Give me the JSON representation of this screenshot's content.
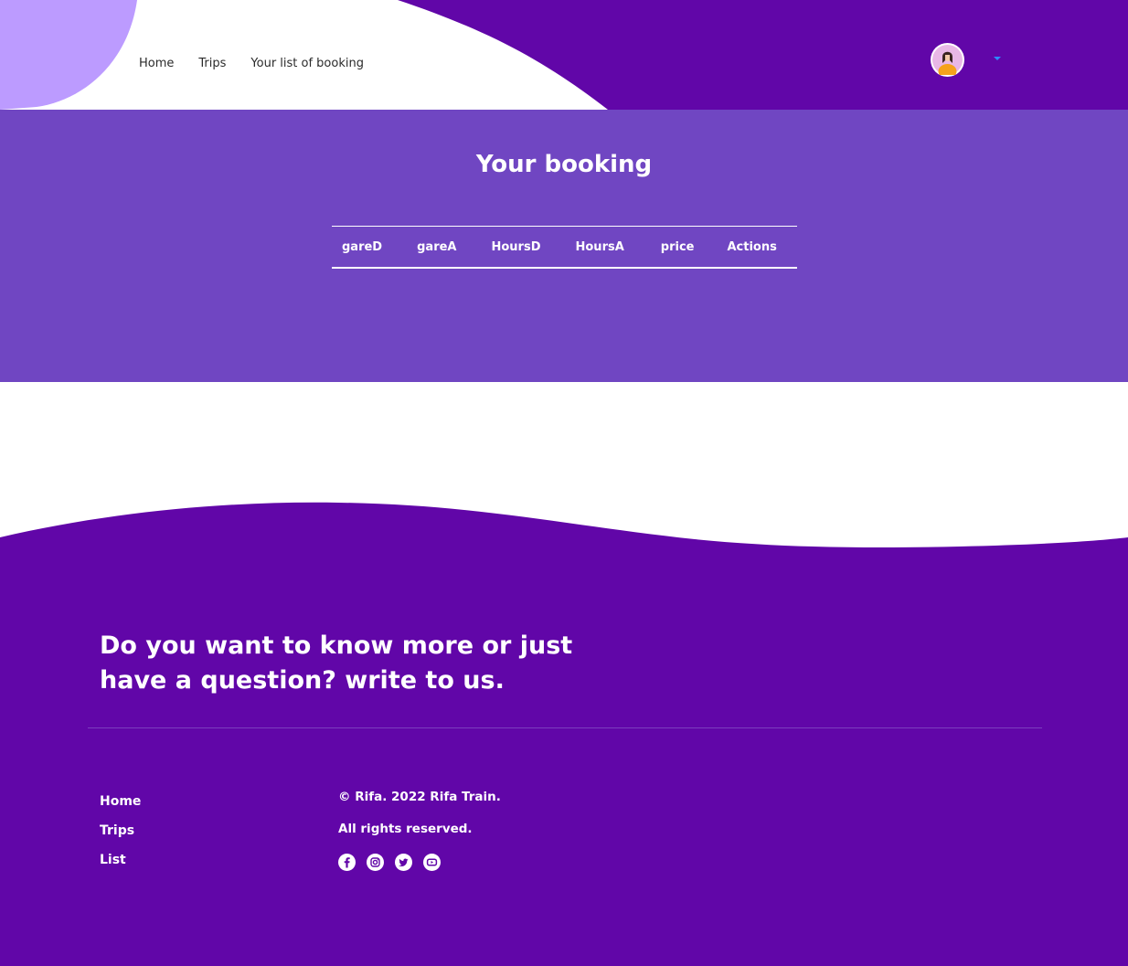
{
  "nav": {
    "items": [
      "Home",
      "Trips",
      "Your list of booking"
    ]
  },
  "user": {
    "avatar_icon": "user-avatar"
  },
  "booking": {
    "title": "Your booking",
    "columns": [
      "gareD",
      "gareA",
      "HoursD",
      "HoursA",
      "price",
      "Actions"
    ],
    "rows": []
  },
  "footer": {
    "cta_line1": "Do you want to know more or just",
    "cta_line2": "have a question? write to us.",
    "links": [
      "Home",
      "Trips",
      "List"
    ],
    "copyright": "© Rifa. 2022 Rifa Train.",
    "rights": "All rights reserved.",
    "socials": [
      "facebook-icon",
      "instagram-icon",
      "twitter-icon",
      "youtube-icon"
    ]
  },
  "colors": {
    "primary": "#6106a8",
    "section": "#7046c2",
    "accent_blob": "#bc9bff",
    "caret": "#2b8cff"
  }
}
